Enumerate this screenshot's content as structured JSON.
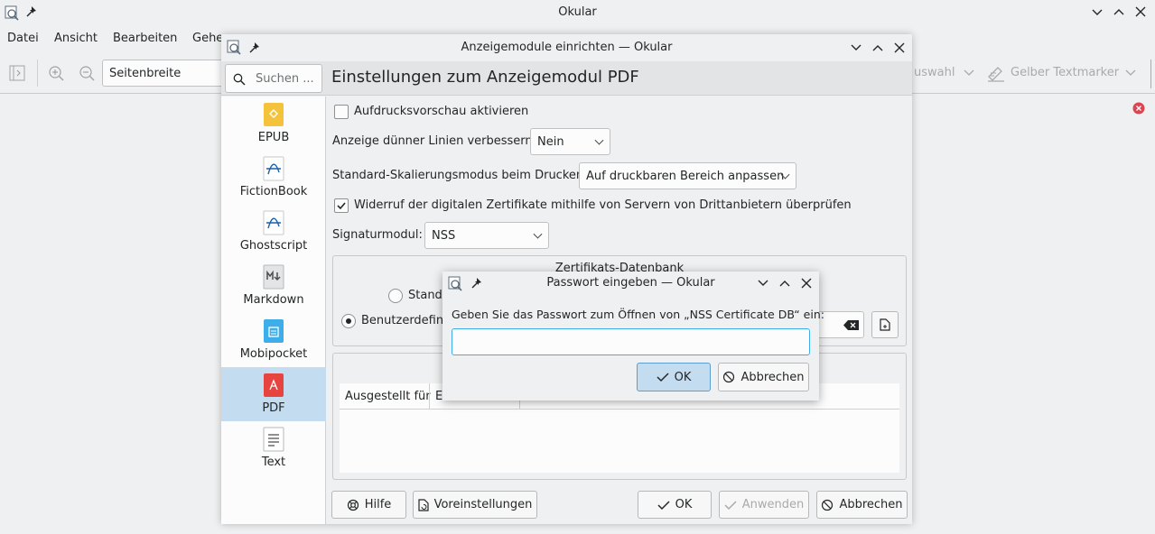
{
  "main_window": {
    "title": "Okular",
    "menu": [
      "Datei",
      "Ansicht",
      "Bearbeiten",
      "Gehe"
    ],
    "zoom_value": "Seitenbreite",
    "toolbar_right": {
      "selection_partial": "uswahl",
      "highlighter": "Gelber Textmarker"
    }
  },
  "config_dialog": {
    "title": "Anzeigemodule einrichten — Okular",
    "search_placeholder": "Suchen ...",
    "heading": "Einstellungen zum Anzeigemodul PDF",
    "sidebar": [
      {
        "label": "EPUB",
        "icon": "epub-icon"
      },
      {
        "label": "FictionBook",
        "icon": "fictionbook-icon"
      },
      {
        "label": "Ghostscript",
        "icon": "ghostscript-icon"
      },
      {
        "label": "Markdown",
        "icon": "markdown-icon"
      },
      {
        "label": "Mobipocket",
        "icon": "mobipocket-icon"
      },
      {
        "label": "PDF",
        "icon": "pdf-icon"
      },
      {
        "label": "Text",
        "icon": "text-icon"
      }
    ],
    "selected_sidebar": "PDF",
    "overprint_preview_label": "Aufdrucksvorschau aktivieren",
    "overprint_preview_checked": false,
    "thin_lines_label": "Anzeige dünner Linien verbessern:",
    "thin_lines_value": "Nein",
    "scaling_label": "Standard-Skalierungsmodus beim Drucken:",
    "scaling_value": "Auf druckbaren Bereich anpassen",
    "revocation_label": "Widerruf der digitalen Zertifikate mithilfe von Servern von Drittanbietern überprüfen",
    "revocation_checked": true,
    "signature_label": "Signaturmodul:",
    "signature_value": "NSS",
    "cert_db_title": "Zertifikats-Datenbank",
    "radio_default_partial": "Standa",
    "radio_custom_partial": "Benutzerdefini",
    "table_headers": [
      "Ausgestellt für",
      "E"
    ],
    "buttons": {
      "help": "Hilfe",
      "defaults": "Voreinstellungen",
      "ok": "OK",
      "apply": "Anwenden",
      "cancel": "Abbrechen"
    }
  },
  "password_dialog": {
    "title": "Passwort eingeben — Okular",
    "prompt": "Geben Sie das Passwort zum Öffnen von „NSS Certificate DB“ ein:",
    "password_value": "",
    "ok": "OK",
    "cancel": "Abbrechen"
  },
  "colors": {
    "accent": "#3daee9",
    "selection": "#c3dcf0",
    "error_badge": "#da4453",
    "pdf_red": "#e8443f",
    "epub_yellow": "#f5c33b",
    "mobi_blue": "#3daee9"
  }
}
